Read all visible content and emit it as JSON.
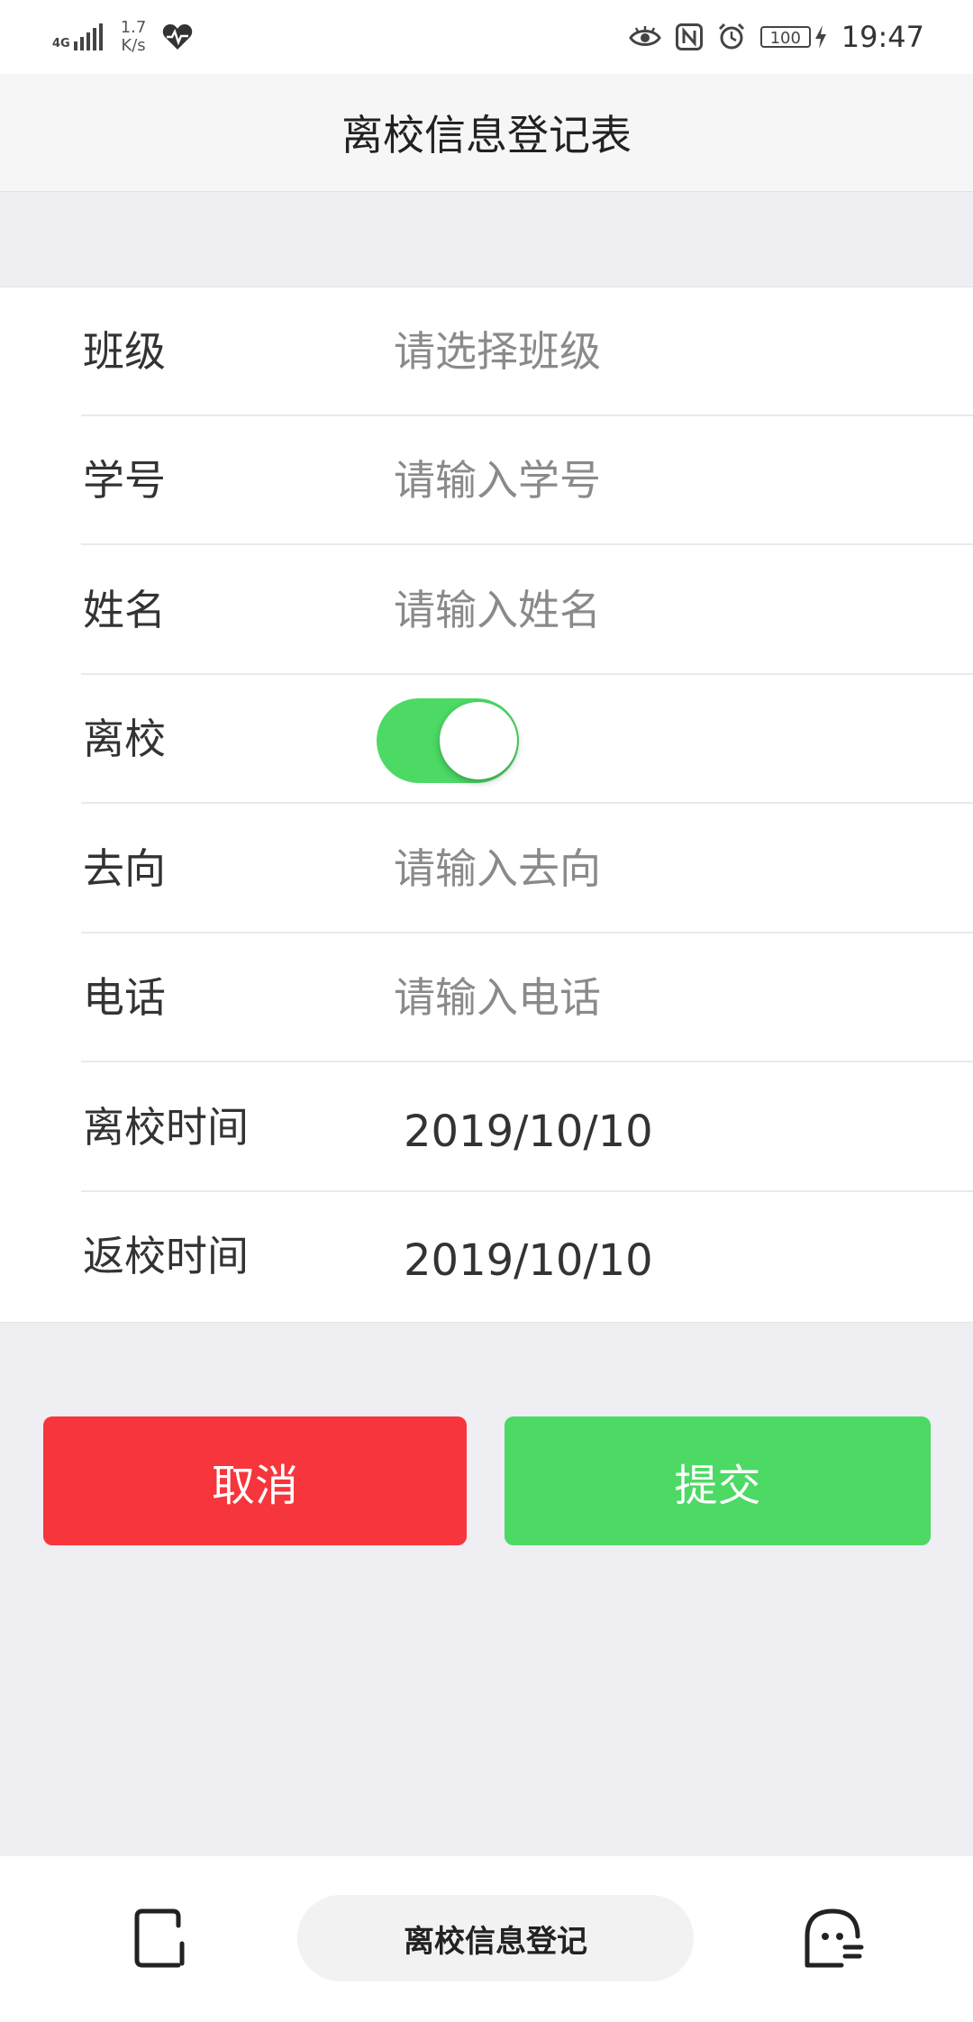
{
  "status_bar": {
    "network_tag": "4G",
    "speed_value": "1.7",
    "speed_unit": "K/s",
    "battery": "100",
    "time": "19:47"
  },
  "header": {
    "title": "离校信息登记表"
  },
  "form": {
    "rows": [
      {
        "label": "班级",
        "placeholder": "请选择班级"
      },
      {
        "label": "学号",
        "placeholder": "请输入学号"
      },
      {
        "label": "姓名",
        "placeholder": "请输入姓名"
      },
      {
        "label": "离校",
        "toggle_on": true
      },
      {
        "label": "去向",
        "placeholder": "请输入去向"
      },
      {
        "label": "电话",
        "placeholder": "请输入电话"
      },
      {
        "label": "离校时间",
        "value": "2019/10/10"
      },
      {
        "label": "返校时间",
        "value": "2019/10/10"
      }
    ]
  },
  "buttons": {
    "cancel": "取消",
    "submit": "提交"
  },
  "bottom_bar": {
    "title": "离校信息登记"
  },
  "colors": {
    "accent_green": "#4cd964",
    "cancel_red": "#f6363c",
    "page_background": "#eeeef3"
  },
  "icons": {
    "status_left": [
      "signal-icon",
      "health-heart-icon"
    ],
    "status_right": [
      "eye-comfort-icon",
      "nfc-icon",
      "alarm-icon",
      "battery-icon",
      "charging-icon"
    ],
    "bottom": [
      "window-icon",
      "assistant-face-icon"
    ]
  }
}
